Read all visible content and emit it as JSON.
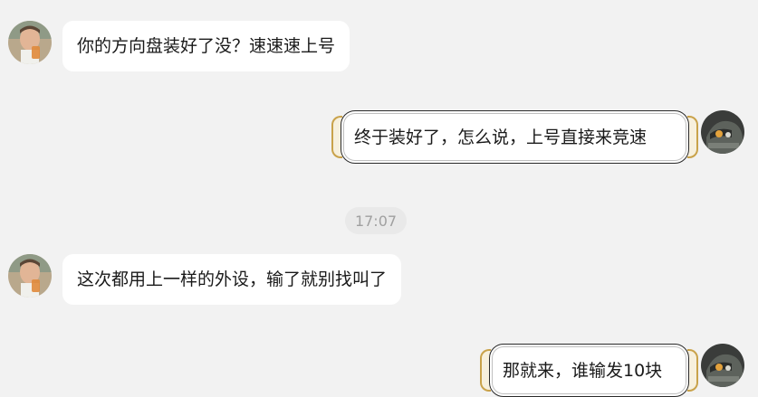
{
  "chat": {
    "messages": [
      {
        "side": "left",
        "text": "你的方向盘装好了没？速速速上号"
      },
      {
        "side": "right",
        "text": "终于装好了，怎么说，上号直接来竞速"
      },
      {
        "side": "left",
        "text": "这次都用上一样的外设，输了就别找叫了"
      },
      {
        "side": "right",
        "text": "那就来，谁输发10块"
      }
    ],
    "timestamp": "17:07"
  },
  "colors": {
    "background": "#f2f2f2",
    "bubble": "#ffffff",
    "frame_gold": "#c9a24a",
    "text": "#1a1a1a",
    "timestamp_text": "#a0a0a0"
  },
  "icons": {
    "contact_avatar": "person-photo-avatar",
    "self_avatar": "robot-helmet-avatar"
  }
}
